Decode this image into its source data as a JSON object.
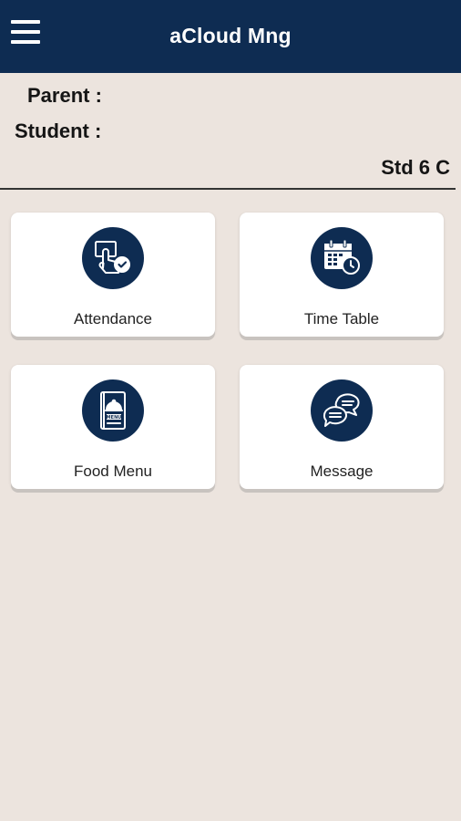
{
  "appbar": {
    "title": "aCloud Mng",
    "menu_icon": "hamburger-menu-icon"
  },
  "info": {
    "parent_label": "Parent :",
    "student_label": "Student :",
    "class_label": "Std 6 C"
  },
  "tiles": [
    {
      "label": "Attendance",
      "icon": "attendance-touch-check-icon"
    },
    {
      "label": "Time Table",
      "icon": "calendar-clock-icon"
    },
    {
      "label": "Food Menu",
      "icon": "food-menu-book-icon"
    },
    {
      "label": "Message",
      "icon": "chat-bubbles-icon"
    }
  ],
  "colors": {
    "primary": "#0e2c52",
    "background": "#ece4de",
    "card": "#ffffff"
  }
}
